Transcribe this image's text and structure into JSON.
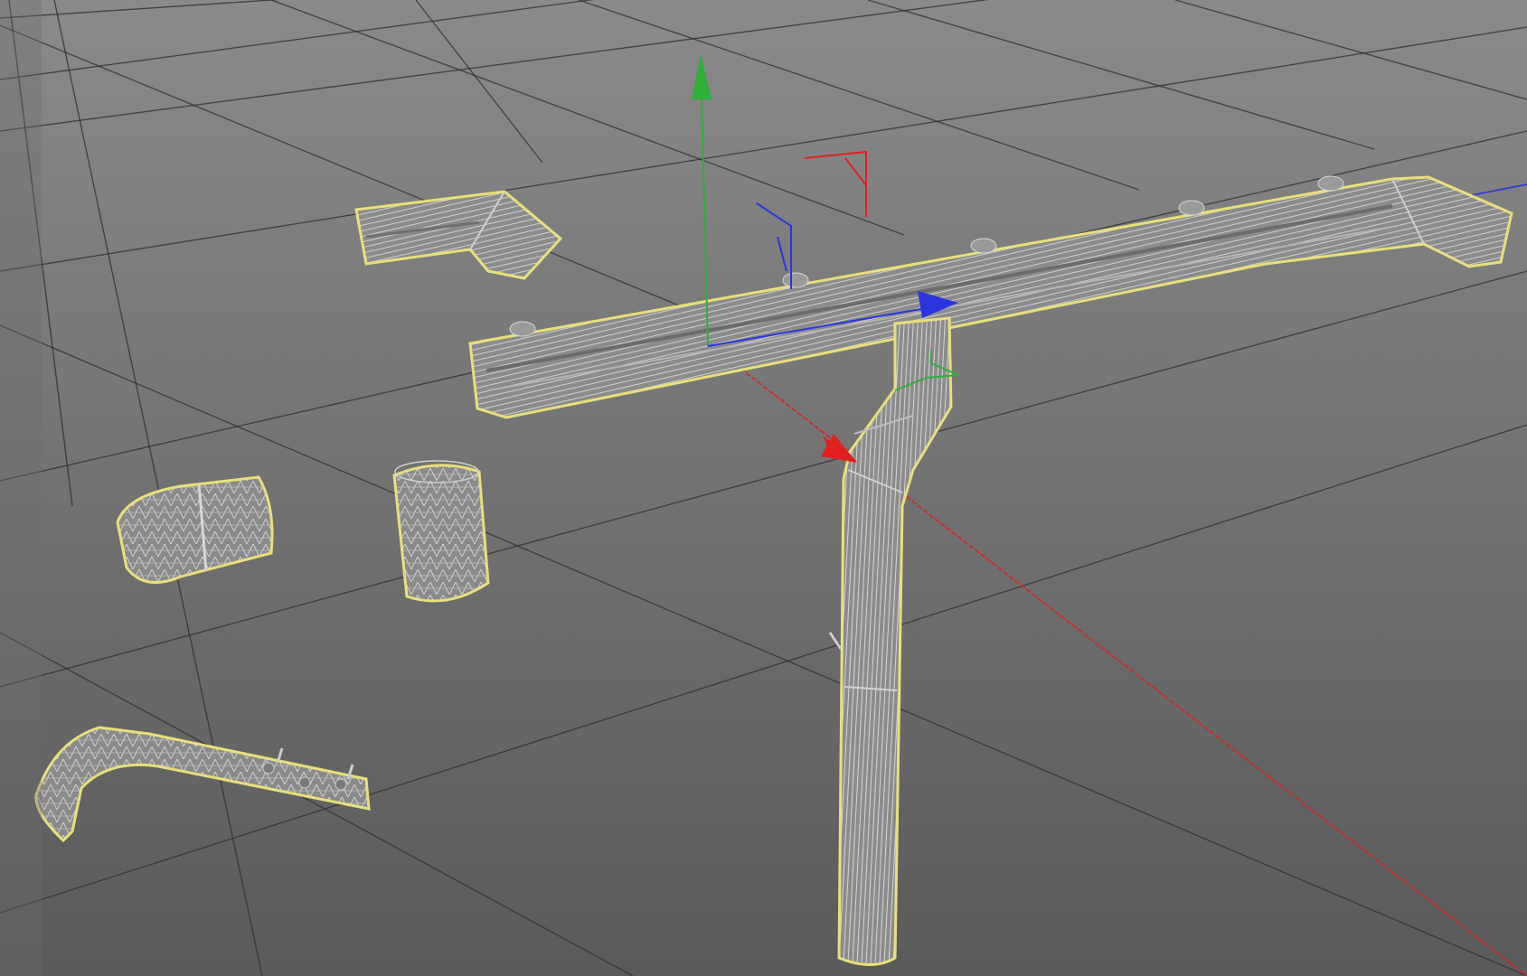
{
  "viewport": {
    "background_top": "#8a8a8a",
    "background_bottom": "#5a5a5a",
    "grid_color": "#2e2e2e",
    "selection_outline": "#e8e07a",
    "mesh_fill": "#8e8e8e",
    "wire_color": "#c8c8c8"
  },
  "axes": {
    "x_color": "#e02020",
    "y_color": "#2fae3a",
    "z_color": "#2a35e0"
  },
  "objects": [
    "gutter-corner-piece",
    "gutter-main-channel",
    "downpipe-elbow",
    "downpipe",
    "gutter-outlet-elbow",
    "pipe-connector",
    "gutter-hanger-bracket"
  ],
  "icons": {
    "world_gizmo": "axis-gizmo-icon",
    "object_gizmo": "local-axis-icon"
  }
}
